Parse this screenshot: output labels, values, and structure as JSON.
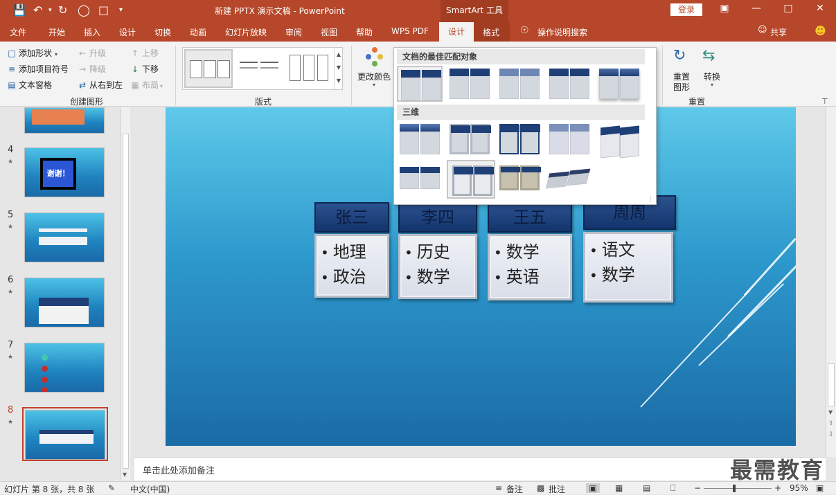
{
  "titlebar": {
    "doc_title": "新建 PPTX 演示文稿  -  PowerPoint",
    "smartart_tools": "SmartArt 工具",
    "login": "登录",
    "quick_access": [
      "save-icon",
      "undo-icon",
      "redo-icon",
      "present-icon",
      "new-icon",
      "customize-icon"
    ]
  },
  "tabs": {
    "file": "文件",
    "home": "开始",
    "insert": "插入",
    "design": "设计",
    "transitions": "切换",
    "animations": "动画",
    "slideshow": "幻灯片放映",
    "review": "审阅",
    "view": "视图",
    "help": "帮助",
    "wpspdf": "WPS PDF",
    "sa_design": "设计",
    "sa_format": "格式",
    "tellme": "操作说明搜索",
    "share": "共享"
  },
  "ribbon": {
    "create_group": {
      "label": "创建图形",
      "add_shape": "添加形状",
      "add_bullet": "添加项目符号",
      "text_pane": "文本窗格",
      "promote": "升级",
      "demote": "降级",
      "rtl": "从右到左",
      "move_up": "上移",
      "move_down": "下移",
      "layout": "布局"
    },
    "layouts_group": {
      "label": "版式"
    },
    "change_colors": "更改颜色",
    "reset_group": {
      "label": "重置",
      "reset_graphic": "重置图形",
      "reset_graphic_l1": "重置",
      "reset_graphic_l2": "图形",
      "convert": "转换"
    }
  },
  "style_panel": {
    "section1": "文档的最佳匹配对象",
    "section2": "三维"
  },
  "slides": [
    {
      "num": "4",
      "thumb_text": "谢谢！"
    },
    {
      "num": "5",
      "thumb_text": ""
    },
    {
      "num": "6",
      "thumb_text": ""
    },
    {
      "num": "7",
      "thumb_text": ""
    },
    {
      "num": "8",
      "thumb_text": ""
    }
  ],
  "smartart": {
    "columns": [
      {
        "name": "张三",
        "items": [
          "地理",
          "政治"
        ]
      },
      {
        "name": "李四",
        "items": [
          "历史",
          "数学"
        ]
      },
      {
        "name": "王五",
        "items": [
          "数学",
          "英语"
        ]
      },
      {
        "name": "周周",
        "items": [
          "语文",
          "数学"
        ]
      }
    ]
  },
  "notes": {
    "placeholder": "单击此处添加备注"
  },
  "watermark": "最需教育",
  "statusbar": {
    "slide_info": "幻灯片 第 8 张，共 8 张",
    "language": "中文(中国)",
    "notes_btn": "备注",
    "comments_btn": "批注",
    "zoom": "95%"
  }
}
